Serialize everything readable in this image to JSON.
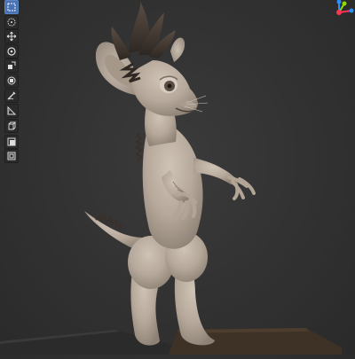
{
  "toolbar": {
    "tools": [
      {
        "icon": "select-box-icon",
        "active": true
      },
      {
        "icon": "cursor-icon",
        "active": false
      },
      {
        "icon": "move-icon",
        "active": false
      },
      {
        "icon": "rotate-icon",
        "active": false
      },
      {
        "icon": "scale-icon",
        "active": false
      },
      {
        "icon": "transform-icon",
        "active": false
      },
      {
        "icon": "annotate-icon",
        "active": false
      },
      {
        "icon": "measure-icon",
        "active": false
      },
      {
        "icon": "add-cube-icon",
        "active": false
      },
      {
        "icon": "extrude-icon",
        "active": false
      },
      {
        "icon": "inset-icon",
        "active": false
      }
    ]
  },
  "gizmo": {
    "axes": [
      {
        "name": "x",
        "color": "#ff3352"
      },
      {
        "name": "y",
        "color": "#8bdc00"
      },
      {
        "name": "z",
        "color": "#2890ff"
      }
    ]
  },
  "colors": {
    "background": "#333333",
    "model": "#b8aca0",
    "model_shadow": "#7e736a",
    "ground": "#2f2f2f",
    "pedestal": "#4a3a2c",
    "accent": "#4772b3"
  }
}
